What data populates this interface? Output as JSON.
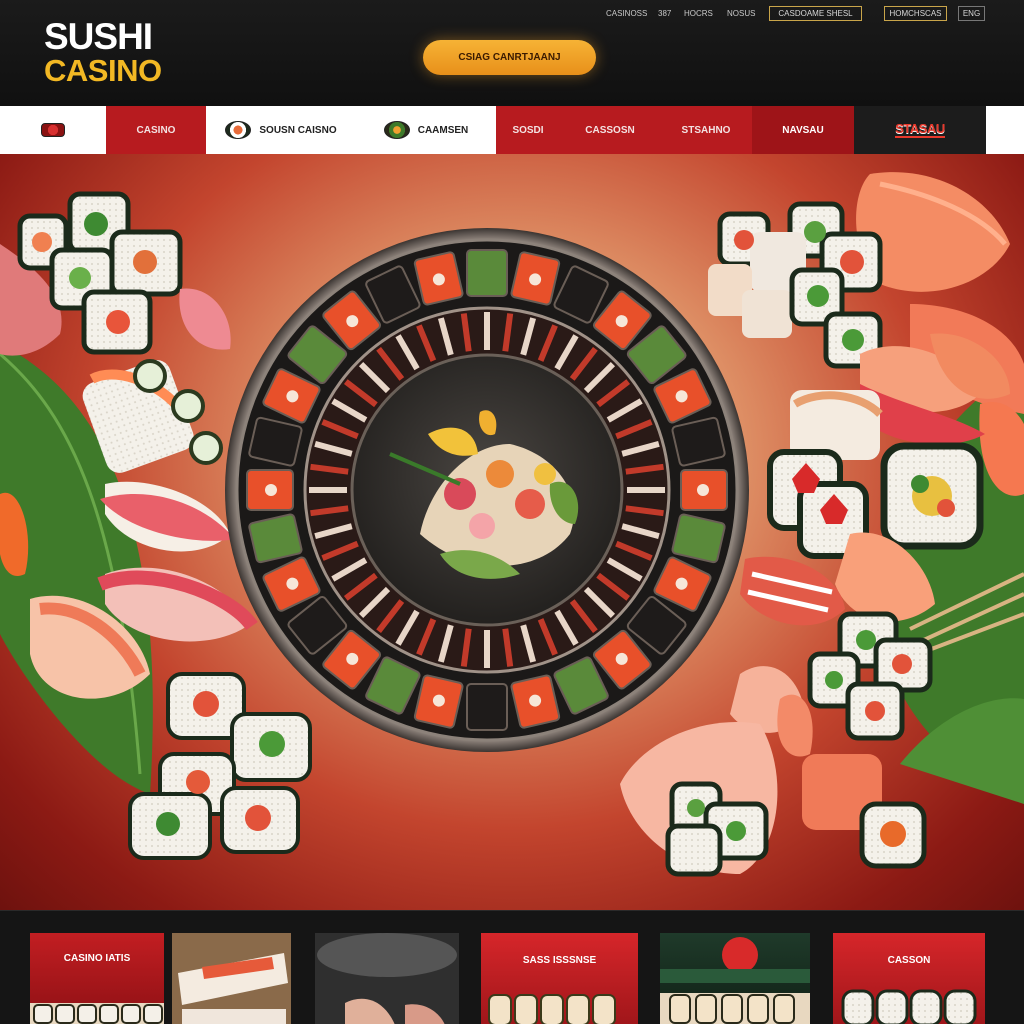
{
  "header": {
    "logo_line1": "SUSHI",
    "logo_line2": "CASINO",
    "top_links": [
      "CASINOSS",
      "387",
      "HOCRS",
      "NOSUS"
    ],
    "top_box_1": "CASDOAME SHESL",
    "top_box_2": "HOMCHSCAS",
    "top_box_3": "ENG",
    "cta_label": "CSIAG CANRTJAANJ"
  },
  "nav": {
    "items": [
      {
        "label": ""
      },
      {
        "label": "CASINO"
      },
      {
        "label": "SOUSN CAISNO"
      },
      {
        "label": "CAAMSEN"
      },
      {
        "label": "SOSDI"
      },
      {
        "label": "CASSOSN"
      },
      {
        "label": "STSAHNO"
      },
      {
        "label": "NAVSAU"
      },
      {
        "label": "STASAU"
      }
    ]
  },
  "cards": [
    {
      "title": "CASINO  IATIS"
    },
    {
      "title": ""
    },
    {
      "title": ""
    },
    {
      "title": "SASS  ISSSNSE"
    },
    {
      "title": ""
    },
    {
      "title": "CASSON"
    }
  ],
  "colors": {
    "brand_red": "#b71b1f",
    "accent_gold": "#f2b824",
    "background": "#161616"
  }
}
